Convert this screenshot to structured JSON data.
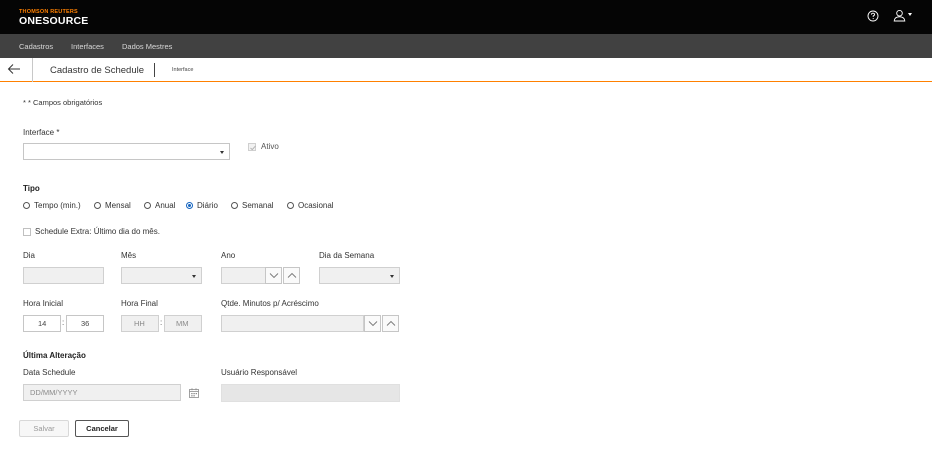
{
  "brand": {
    "top": "THOMSON REUTERS",
    "bottom": "ONESOURCE",
    "accent": "#ff8000"
  },
  "topbar_icons": {
    "help": "help-circle-icon",
    "user": "user-icon"
  },
  "menu": {
    "items": [
      "Cadastros",
      "Interfaces",
      "Dados Mestres"
    ]
  },
  "header": {
    "title": "Cadastro de Schedule",
    "subtitle": "Interface",
    "back": "back-arrow-icon"
  },
  "form": {
    "required_note": "* * Campos obrigatórios",
    "interface": {
      "label": "Interface *",
      "value": ""
    },
    "ativo": {
      "label": "Ativo",
      "checked": true,
      "disabled": true
    },
    "tipo": {
      "label": "Tipo",
      "options": [
        "Tempo (min.)",
        "Mensal",
        "Anual",
        "Diário",
        "Semanal",
        "Ocasional"
      ],
      "selected": "Diário"
    },
    "schedule_extra": {
      "label": "Schedule Extra: Último dia do mês.",
      "checked": false
    },
    "dia": {
      "label": "Dia",
      "value": ""
    },
    "mes": {
      "label": "Mês",
      "value": ""
    },
    "ano": {
      "label": "Ano",
      "value": ""
    },
    "dia_semana": {
      "label": "Dia da Semana",
      "value": ""
    },
    "hora_inicial": {
      "label": "Hora Inicial",
      "hh": "14",
      "mm": "36"
    },
    "hora_final": {
      "label": "Hora Final",
      "hh_placeholder": "HH",
      "mm_placeholder": "MM"
    },
    "qtde_minutos": {
      "label": "Qtde. Minutos p/ Acréscimo",
      "value": ""
    },
    "ultima_alteracao": {
      "label": "Última Alteração",
      "data_schedule": {
        "label": "Data Schedule",
        "placeholder": "DD/MM/YYYY"
      },
      "usuario": {
        "label": "Usuário Responsável",
        "value": ""
      }
    }
  },
  "buttons": {
    "salvar": "Salvar",
    "cancelar": "Cancelar"
  },
  "colors": {
    "radio_selected": "#1565c0",
    "topbar": "#050505",
    "menubar": "#414141"
  }
}
